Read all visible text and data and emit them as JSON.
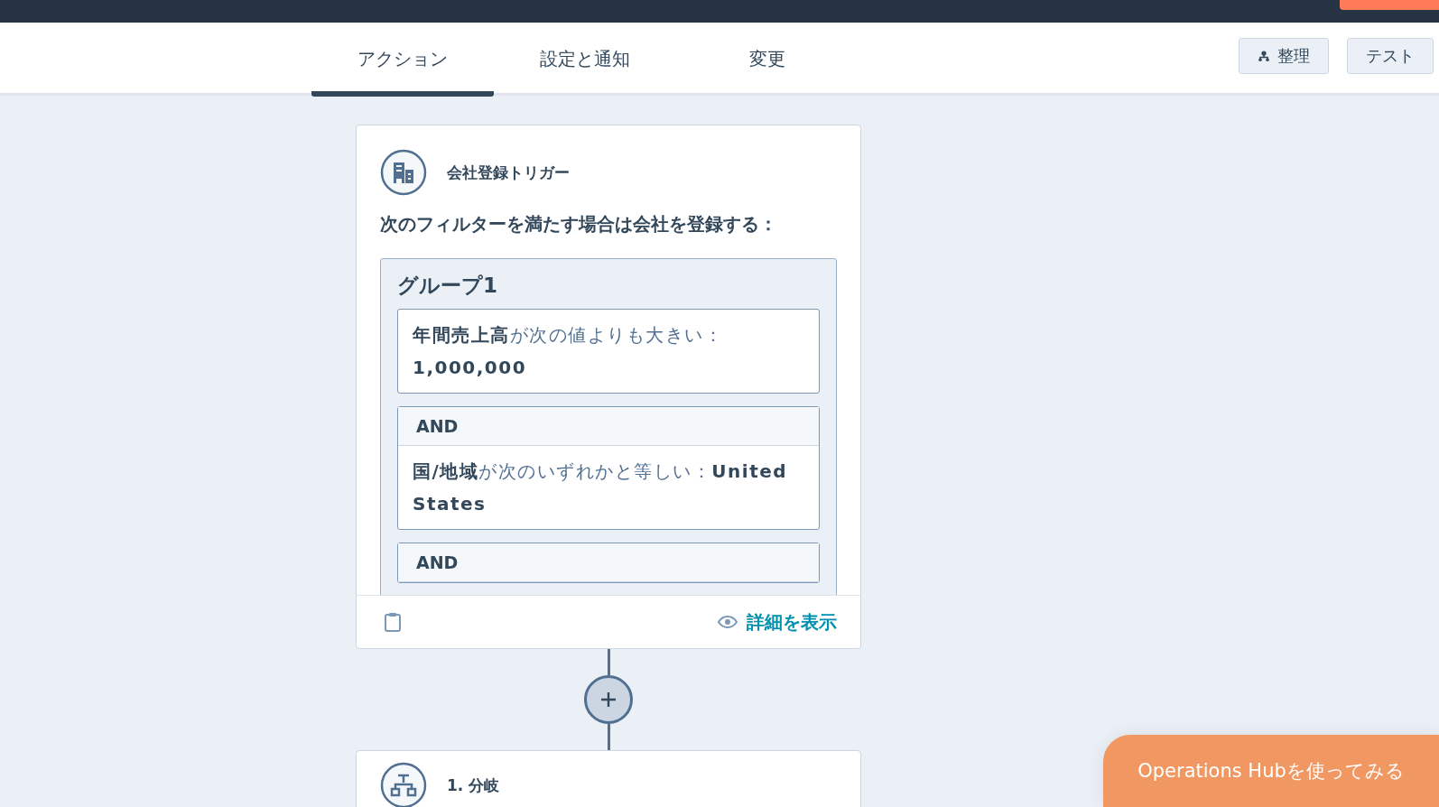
{
  "tabs": [
    {
      "label": "アクション",
      "selected": true
    },
    {
      "label": "設定と通知",
      "selected": false
    },
    {
      "label": "変更",
      "selected": false
    }
  ],
  "toolbar_buttons": [
    {
      "label": "整理",
      "kind": "icon"
    },
    {
      "label": "テスト",
      "kind": "plain"
    }
  ],
  "trigger_card": {
    "title": "会社登録トリガー",
    "description": "次のフィルターを満たす場合は会社を登録する：",
    "group": {
      "title": "グループ1",
      "conditions": [
        {
          "text": "**年間売上高**が次の値よりも大きい：**1,000,000**"
        },
        {
          "connector": "AND",
          "text": "**国/地域**が次のいずれかと等しい：**United States**"
        },
        {
          "connector": "AND"
        }
      ]
    },
    "footer_link": "詳細を表示"
  },
  "step_card": {
    "title": "1. 分岐"
  },
  "promo_button": "Operations Hubを使ってみる"
}
